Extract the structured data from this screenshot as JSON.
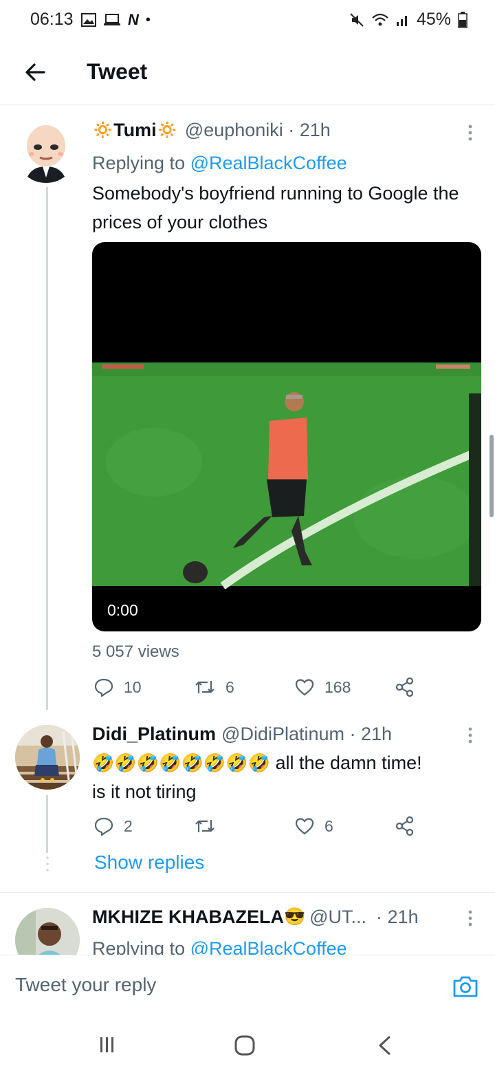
{
  "status_bar": {
    "time": "06:13",
    "n_icon": "N",
    "dot": "•",
    "battery": "45%"
  },
  "header": {
    "title": "Tweet"
  },
  "tweet1": {
    "name": "Tumi",
    "name_emoji_left": "🔅",
    "name_emoji_right": "🔅",
    "handle_time": "@euphoniki · 21h",
    "replying_prefix": "Replying to ",
    "replying_handle": "@RealBlackCoffee",
    "text": "Somebody's boyfriend running to Google the prices of your clothes",
    "video_time": "0:00",
    "views": "5 057 views",
    "replies": "10",
    "retweets": "6",
    "likes": "168"
  },
  "tweet2": {
    "name": "Didi_Platinum",
    "handle_time": "@DidiPlatinum · 21h",
    "emojis": "🤣🤣🤣🤣🤣🤣🤣🤣",
    "text_after_emoji": " all the damn time!",
    "text_line2": "is it not tiring",
    "replies": "2",
    "retweets": "",
    "likes": "6",
    "show_replies": "Show replies"
  },
  "tweet3": {
    "name": "MKHIZE KHABAZELA",
    "name_emoji": "😎",
    "handle": "@UT...",
    "time": "· 21h",
    "replying_prefix": "Replying to ",
    "replying_handle": "@RealBlackCoffee"
  },
  "composer": {
    "placeholder": "Tweet your reply"
  },
  "colors": {
    "link": "#1d9bf0",
    "muted": "#536471",
    "text": "#0f1419"
  }
}
